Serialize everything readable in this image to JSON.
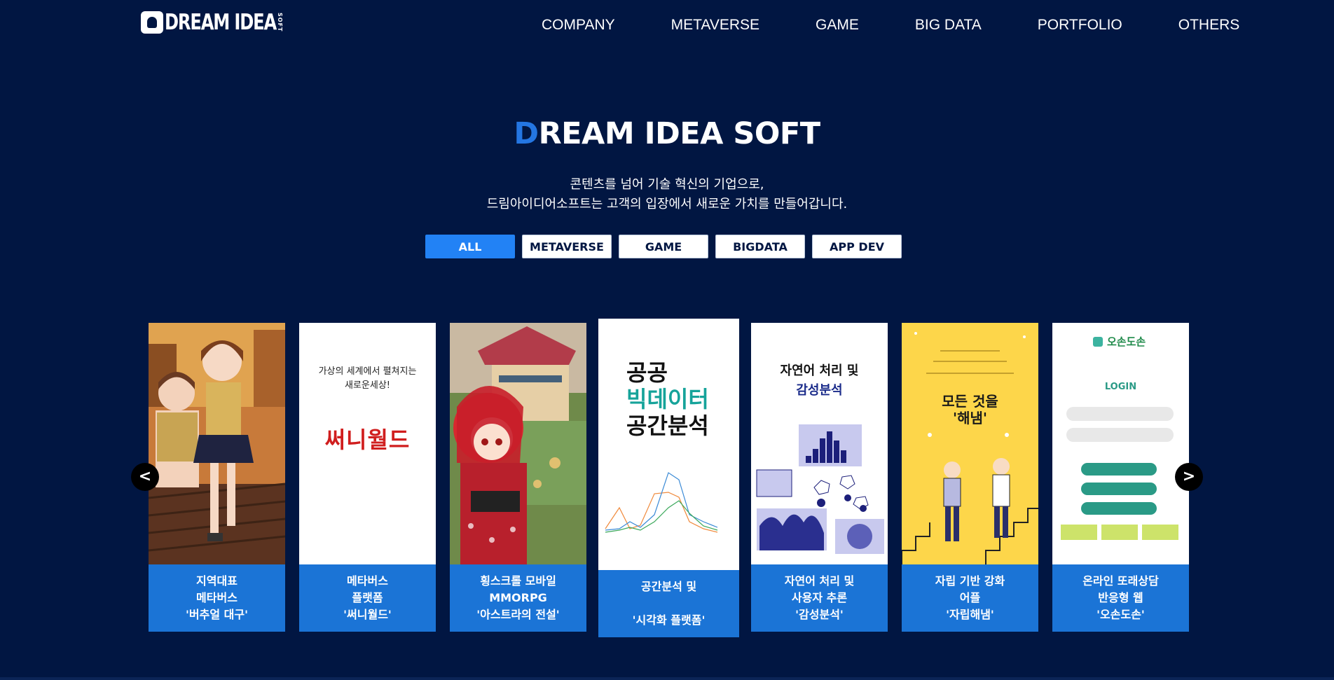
{
  "header": {
    "logo_text": "DREAM IDEA",
    "logo_sub": "SOFT",
    "nav": [
      "COMPANY",
      "METAVERSE",
      "GAME",
      "BIG DATA",
      "PORTFOLIO",
      "OTHERS"
    ]
  },
  "hero": {
    "title_first": "D",
    "title_rest": "REAM IDEA SOFT",
    "subtitle_line1": "콘텐츠를 넘어 기술 혁신의 기업으로,",
    "subtitle_line2": "드림아이디어소프트는 고객의 입장에서 새로운 가치를 만들어갑니다."
  },
  "filters": [
    {
      "label": "ALL",
      "active": true
    },
    {
      "label": "METAVERSE",
      "active": false
    },
    {
      "label": "GAME",
      "active": false
    },
    {
      "label": "BIGDATA",
      "active": false
    },
    {
      "label": "APP DEV",
      "active": false
    }
  ],
  "carousel": {
    "prev_label": "<",
    "next_label": ">",
    "cards": [
      {
        "lines": [
          "지역대표",
          "메타버스",
          "'버추얼 대구'"
        ]
      },
      {
        "lines": [
          "메타버스",
          "플랫폼",
          "'써니월드'"
        ],
        "image_text_1": "가상의 세계에서 펼쳐지는",
        "image_text_2": "새로운세상!",
        "image_title": "써니월드"
      },
      {
        "lines": [
          "횡스크롤 모바일",
          "MMORPG",
          "'아스트라의 전설'"
        ]
      },
      {
        "lines": [
          "공간분석 및",
          "",
          "'시각화 플랫폼'"
        ],
        "image_text_1": "공공",
        "image_text_2": "빅데이터",
        "image_text_3": "공간분석"
      },
      {
        "lines": [
          "자연어 처리 및",
          "사용자 추론",
          "'감성분석'"
        ],
        "image_text_1": "자연어 처리 및",
        "image_text_2": "감성분석"
      },
      {
        "lines": [
          "자립 기반 강화",
          "어플",
          "'자립해냄'"
        ],
        "image_text_1": "모든 것을",
        "image_text_2": "'해냄'"
      },
      {
        "lines": [
          "온라인 또래상담",
          "반응형 웹",
          "'오손도손'"
        ],
        "image_text_1": "오손도손",
        "image_text_2": "LOGIN"
      }
    ]
  },
  "colors": {
    "background": "#011642",
    "accent": "#2476e2",
    "caption": "#1b74d6",
    "active_filter": "#2282f5"
  }
}
